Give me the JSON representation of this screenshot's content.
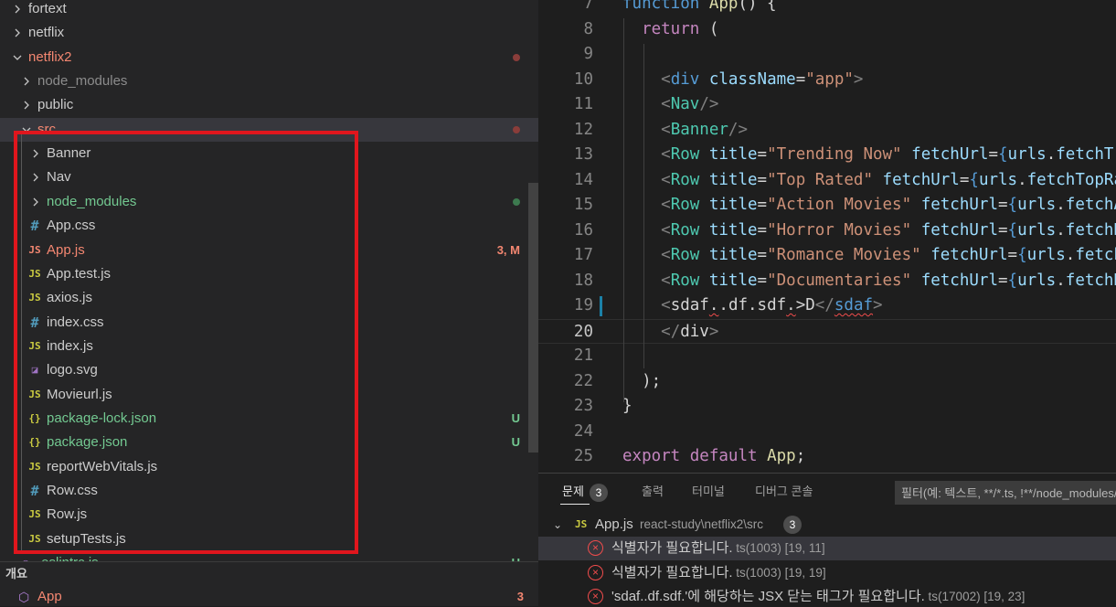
{
  "colors": {
    "folder_modified": "#f48771",
    "untracked": "#73c991",
    "js_icon": "#cbcb41",
    "css_icon": "#519aba",
    "json_icon": "#cbcb41",
    "svg_icon": "#a074c4",
    "ignored": "#8c8c8c",
    "default": "#cccccc",
    "highlight_box": "#e0161d"
  },
  "explorer": {
    "items": [
      {
        "type": "folder",
        "open": false,
        "depth": 0,
        "label": "fortext",
        "color": "default"
      },
      {
        "type": "folder",
        "open": false,
        "depth": 0,
        "label": "netflix",
        "color": "default"
      },
      {
        "type": "folder",
        "open": true,
        "depth": 0,
        "label": "netflix2",
        "color": "folder_modified",
        "dot": "#8a3d3a"
      },
      {
        "type": "folder",
        "open": false,
        "depth": 1,
        "label": "node_modules",
        "color": "ignored"
      },
      {
        "type": "folder",
        "open": false,
        "depth": 1,
        "label": "public",
        "color": "default"
      },
      {
        "type": "folder",
        "open": true,
        "depth": 1,
        "label": "src",
        "color": "folder_modified",
        "dot": "#8a3d3a",
        "selected": true
      },
      {
        "type": "folder",
        "open": false,
        "depth": 2,
        "label": "Banner",
        "color": "default"
      },
      {
        "type": "folder",
        "open": false,
        "depth": 2,
        "label": "Nav",
        "color": "default"
      },
      {
        "type": "folder",
        "open": false,
        "depth": 2,
        "label": "node_modules",
        "color": "untracked",
        "dot": "#3d7a4f"
      },
      {
        "type": "file",
        "icon": "#",
        "icon_color": "css_icon",
        "depth": 2,
        "label": "App.css",
        "color": "default"
      },
      {
        "type": "file",
        "icon": "JS",
        "icon_color": "folder_modified",
        "depth": 2,
        "label": "App.js",
        "color": "folder_modified",
        "badge": "3, M"
      },
      {
        "type": "file",
        "icon": "JS",
        "icon_color": "js_icon",
        "depth": 2,
        "label": "App.test.js",
        "color": "default"
      },
      {
        "type": "file",
        "icon": "JS",
        "icon_color": "js_icon",
        "depth": 2,
        "label": "axios.js",
        "color": "default"
      },
      {
        "type": "file",
        "icon": "#",
        "icon_color": "css_icon",
        "depth": 2,
        "label": "index.css",
        "color": "default"
      },
      {
        "type": "file",
        "icon": "JS",
        "icon_color": "js_icon",
        "depth": 2,
        "label": "index.js",
        "color": "default"
      },
      {
        "type": "file",
        "icon": "◪",
        "icon_color": "svg_icon",
        "depth": 2,
        "label": "logo.svg",
        "color": "default"
      },
      {
        "type": "file",
        "icon": "JS",
        "icon_color": "js_icon",
        "depth": 2,
        "label": "Movieurl.js",
        "color": "default"
      },
      {
        "type": "file",
        "icon": "{}",
        "icon_color": "json_icon",
        "depth": 2,
        "label": "package-lock.json",
        "color": "untracked",
        "badge": "U"
      },
      {
        "type": "file",
        "icon": "{}",
        "icon_color": "json_icon",
        "depth": 2,
        "label": "package.json",
        "color": "untracked",
        "badge": "U"
      },
      {
        "type": "file",
        "icon": "JS",
        "icon_color": "js_icon",
        "depth": 2,
        "label": "reportWebVitals.js",
        "color": "default"
      },
      {
        "type": "file",
        "icon": "#",
        "icon_color": "css_icon",
        "depth": 2,
        "label": "Row.css",
        "color": "default"
      },
      {
        "type": "file",
        "icon": "JS",
        "icon_color": "js_icon",
        "depth": 2,
        "label": "Row.js",
        "color": "default"
      },
      {
        "type": "file",
        "icon": "JS",
        "icon_color": "js_icon",
        "depth": 2,
        "label": "setupTests.js",
        "color": "default"
      },
      {
        "type": "file",
        "icon": "◉",
        "icon_color": "svg_icon",
        "depth": 1,
        "label": ".eslintrc.js",
        "color": "untracked",
        "badge": "U"
      }
    ]
  },
  "outline": {
    "title": "개요",
    "item_label": "App",
    "item_badge": "3"
  },
  "editor": {
    "lines": [
      {
        "n": "7",
        "tokens": [
          [
            "function ",
            "kw"
          ],
          [
            "App",
            "fn"
          ],
          [
            "() {",
            "p"
          ]
        ]
      },
      {
        "n": "8",
        "tokens": [
          [
            "  ",
            ""
          ],
          [
            "return",
            "kw2"
          ],
          [
            " (",
            "p"
          ]
        ]
      },
      {
        "n": "9",
        "tokens": []
      },
      {
        "n": "10",
        "tokens": [
          [
            "    ",
            ""
          ],
          [
            "<",
            "tag"
          ],
          [
            "div",
            "tagname"
          ],
          [
            " ",
            ""
          ],
          [
            "className",
            "attr"
          ],
          [
            "=",
            "p"
          ],
          [
            "\"app\"",
            "str"
          ],
          [
            ">",
            "tag"
          ]
        ]
      },
      {
        "n": "11",
        "tokens": [
          [
            "    ",
            ""
          ],
          [
            "<",
            "tag"
          ],
          [
            "Nav",
            "comp"
          ],
          [
            "/>",
            "tag"
          ]
        ]
      },
      {
        "n": "12",
        "tokens": [
          [
            "    ",
            ""
          ],
          [
            "<",
            "tag"
          ],
          [
            "Banner",
            "comp"
          ],
          [
            "/>",
            "tag"
          ]
        ]
      },
      {
        "n": "13",
        "tokens": [
          [
            "    ",
            ""
          ],
          [
            "<",
            "tag"
          ],
          [
            "Row",
            "comp"
          ],
          [
            " ",
            ""
          ],
          [
            "title",
            "attr"
          ],
          [
            "=",
            "p"
          ],
          [
            "\"Trending Now\"",
            "str"
          ],
          [
            " ",
            ""
          ],
          [
            "fetchUrl",
            "attr"
          ],
          [
            "=",
            "p"
          ],
          [
            "{",
            "brace"
          ],
          [
            "urls",
            "var"
          ],
          [
            ".",
            "p"
          ],
          [
            "fetchTrending",
            "var"
          ]
        ]
      },
      {
        "n": "14",
        "tokens": [
          [
            "    ",
            ""
          ],
          [
            "<",
            "tag"
          ],
          [
            "Row",
            "comp"
          ],
          [
            " ",
            ""
          ],
          [
            "title",
            "attr"
          ],
          [
            "=",
            "p"
          ],
          [
            "\"Top Rated\"",
            "str"
          ],
          [
            " ",
            ""
          ],
          [
            "fetchUrl",
            "attr"
          ],
          [
            "=",
            "p"
          ],
          [
            "{",
            "brace"
          ],
          [
            "urls",
            "var"
          ],
          [
            ".",
            "p"
          ],
          [
            "fetchTopRated",
            "var"
          ]
        ]
      },
      {
        "n": "15",
        "tokens": [
          [
            "    ",
            ""
          ],
          [
            "<",
            "tag"
          ],
          [
            "Row",
            "comp"
          ],
          [
            " ",
            ""
          ],
          [
            "title",
            "attr"
          ],
          [
            "=",
            "p"
          ],
          [
            "\"Action Movies\"",
            "str"
          ],
          [
            " ",
            ""
          ],
          [
            "fetchUrl",
            "attr"
          ],
          [
            "=",
            "p"
          ],
          [
            "{",
            "brace"
          ],
          [
            "urls",
            "var"
          ],
          [
            ".",
            "p"
          ],
          [
            "fetchAction",
            "var"
          ]
        ]
      },
      {
        "n": "16",
        "tokens": [
          [
            "    ",
            ""
          ],
          [
            "<",
            "tag"
          ],
          [
            "Row",
            "comp"
          ],
          [
            " ",
            ""
          ],
          [
            "title",
            "attr"
          ],
          [
            "=",
            "p"
          ],
          [
            "\"Horror Movies\"",
            "str"
          ],
          [
            " ",
            ""
          ],
          [
            "fetchUrl",
            "attr"
          ],
          [
            "=",
            "p"
          ],
          [
            "{",
            "brace"
          ],
          [
            "urls",
            "var"
          ],
          [
            ".",
            "p"
          ],
          [
            "fetchHorror",
            "var"
          ]
        ]
      },
      {
        "n": "17",
        "tokens": [
          [
            "    ",
            ""
          ],
          [
            "<",
            "tag"
          ],
          [
            "Row",
            "comp"
          ],
          [
            " ",
            ""
          ],
          [
            "title",
            "attr"
          ],
          [
            "=",
            "p"
          ],
          [
            "\"Romance Movies\"",
            "str"
          ],
          [
            " ",
            ""
          ],
          [
            "fetchUrl",
            "attr"
          ],
          [
            "=",
            "p"
          ],
          [
            "{",
            "brace"
          ],
          [
            "urls",
            "var"
          ],
          [
            ".",
            "p"
          ],
          [
            "fetchRomance",
            "var"
          ]
        ]
      },
      {
        "n": "18",
        "tokens": [
          [
            "    ",
            ""
          ],
          [
            "<",
            "tag"
          ],
          [
            "Row",
            "comp"
          ],
          [
            " ",
            ""
          ],
          [
            "title",
            "attr"
          ],
          [
            "=",
            "p"
          ],
          [
            "\"Documentaries\"",
            "str"
          ],
          [
            " ",
            ""
          ],
          [
            "fetchUrl",
            "attr"
          ],
          [
            "=",
            "p"
          ],
          [
            "{",
            "brace"
          ],
          [
            "urls",
            "var"
          ],
          [
            ".",
            "p"
          ],
          [
            "fetchDocs",
            "var"
          ]
        ]
      },
      {
        "n": "19",
        "tokens": [
          [
            "    ",
            ""
          ],
          [
            "<",
            "tag"
          ],
          [
            "sdaf",
            "p"
          ],
          [
            ".",
            "sq"
          ],
          [
            ".df.sdf",
            "p"
          ],
          [
            ".",
            "sq"
          ],
          [
            ">D",
            "p"
          ],
          [
            "</",
            "tag"
          ],
          [
            "sdaf",
            "sqcomp"
          ],
          [
            ">",
            "tag"
          ]
        ]
      },
      {
        "n": "20",
        "tokens": [
          [
            "    ",
            ""
          ],
          [
            "</",
            "tag"
          ],
          [
            "div",
            "p"
          ],
          [
            ">",
            "tag"
          ]
        ],
        "current": true
      },
      {
        "n": "21",
        "tokens": []
      },
      {
        "n": "22",
        "tokens": [
          [
            "  ",
            ""
          ],
          [
            ");",
            "p"
          ]
        ]
      },
      {
        "n": "23",
        "tokens": [
          [
            "}",
            "p"
          ]
        ]
      },
      {
        "n": "24",
        "tokens": []
      },
      {
        "n": "25",
        "tokens": [
          [
            "export",
            "kw2"
          ],
          [
            " ",
            ""
          ],
          [
            "default",
            "kw2"
          ],
          [
            " ",
            ""
          ],
          [
            "App",
            "fn"
          ],
          [
            ";",
            "p"
          ]
        ]
      }
    ]
  },
  "panel": {
    "tabs": [
      {
        "label": "문제",
        "badge": "3",
        "active": true
      },
      {
        "label": "출력"
      },
      {
        "label": "터미널"
      },
      {
        "label": "디버그 콘솔"
      }
    ],
    "filter_placeholder": "필터(예: 텍스트, **/*.ts, !**/node_modules/**)",
    "group": {
      "file": "App.js",
      "path": "react-study\\netflix2\\src",
      "count": "3"
    },
    "problems": [
      {
        "msg": "식별자가 필요합니다.",
        "code": "ts(1003)",
        "pos": "[19, 11]",
        "selected": true
      },
      {
        "msg": "식별자가 필요합니다.",
        "code": "ts(1003)",
        "pos": "[19, 19]"
      },
      {
        "msg": "'sdaf..df.sdf.'에 해당하는 JSX 닫는 태그가 필요합니다.",
        "code": "ts(17002)",
        "pos": "[19, 23]"
      }
    ]
  }
}
